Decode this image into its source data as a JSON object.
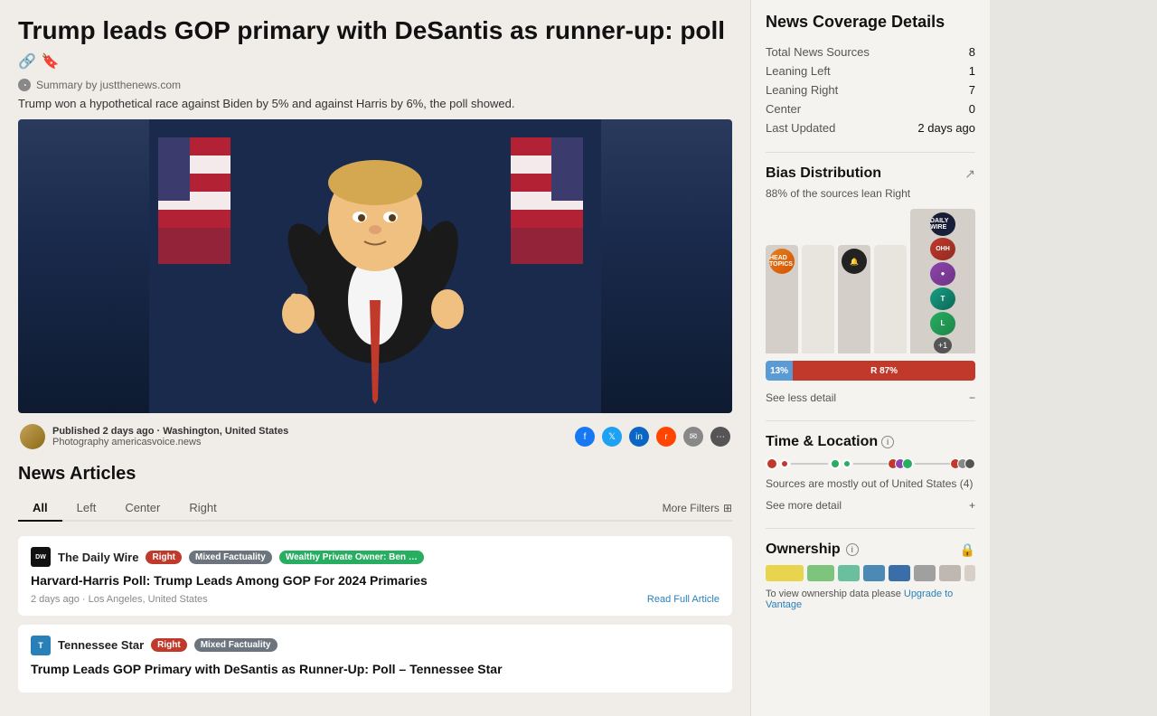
{
  "article": {
    "title": "Trump leads GOP primary with DeSantis as runner-up: poll",
    "summary_label": "Summary by justthenews.com",
    "description": "Trump won a hypothetical race against Biden by 5% and against Harris by 6%, the poll showed.",
    "published": "Published 2 days ago · Washington, United States",
    "photography": "Photography americasvoice.news"
  },
  "news_articles": {
    "section_title": "News Articles",
    "filters": {
      "all": "All",
      "left": "Left",
      "center": "Center",
      "right": "Right",
      "more": "More Filters"
    },
    "articles": [
      {
        "source": "The Daily Wire",
        "source_short": "DW",
        "bias": "Right",
        "factuality": "Mixed Factuality",
        "owner": "Wealthy Private Owner: Ben Shapiro",
        "title": "Harvard-Harris Poll: Trump Leads Among GOP For 2024 Primaries",
        "meta": "2 days ago · Los Angeles, United States",
        "read_link": "Read Full Article"
      },
      {
        "source": "Tennessee Star",
        "source_short": "T",
        "bias": "Right",
        "factuality": "Mixed Factuality",
        "owner": null,
        "title": "Trump Leads GOP Primary with DeSantis as Runner-Up: Poll – Tennessee Star",
        "meta": "",
        "read_link": ""
      }
    ]
  },
  "sidebar": {
    "title": "News Coverage Details",
    "stats": {
      "total_sources_label": "Total News Sources",
      "total_sources_value": "8",
      "leaning_left_label": "Leaning Left",
      "leaning_left_value": "1",
      "leaning_right_label": "Leaning Right",
      "leaning_right_value": "7",
      "center_label": "Center",
      "center_value": "0",
      "last_updated_label": "Last Updated",
      "last_updated_value": "2 days ago"
    },
    "bias_distribution": {
      "title": "Bias Distribution",
      "expand_icon": "↗",
      "subtitle": "88% of the sources lean Right",
      "bar_left_pct": "13%",
      "bar_right_label": "R 87%",
      "see_less": "See less detail",
      "minus_icon": "−"
    },
    "time_location": {
      "title": "Time & Location",
      "info": "ℹ",
      "sources_text": "Sources are mostly out of United States (4)",
      "see_more": "See more detail",
      "plus_icon": "+"
    },
    "ownership": {
      "title": "Ownership",
      "info": "ℹ",
      "lock_icon": "🔒",
      "text": "To view ownership data please",
      "upgrade_label": "Upgrade to Vantage"
    }
  },
  "icons": {
    "link": "🔗",
    "bookmark": "🔖",
    "filter": "⊞"
  }
}
